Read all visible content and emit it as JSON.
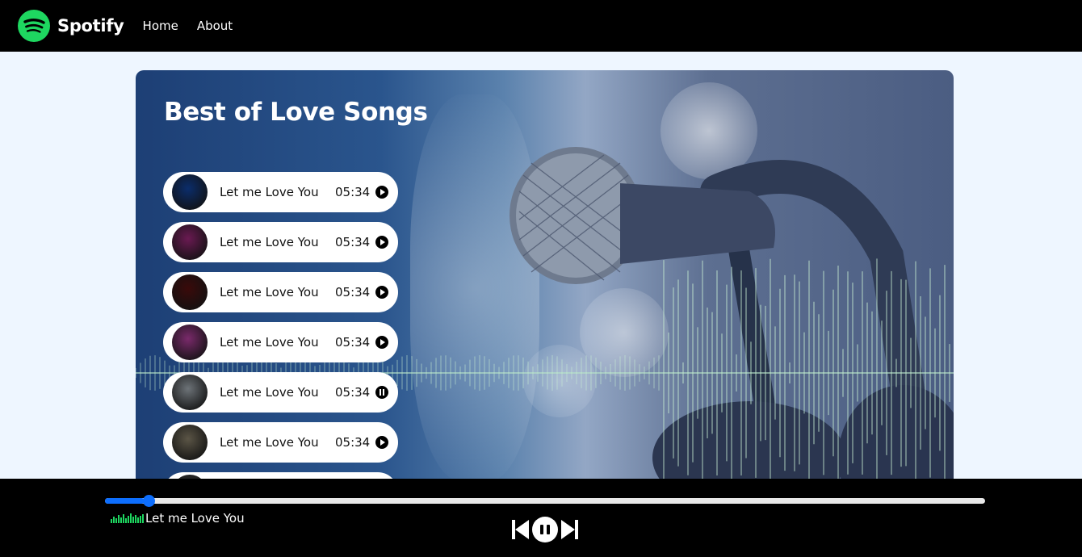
{
  "navbar": {
    "brand": "Spotify",
    "links": [
      "Home",
      "About"
    ]
  },
  "hero": {
    "title": "Best of Love Songs"
  },
  "songs": [
    {
      "name": "Let me Love You",
      "duration": "05:34",
      "state": "play",
      "cover_color": "#0b2d6b"
    },
    {
      "name": "Let me Love You",
      "duration": "05:34",
      "state": "play",
      "cover_color": "#6a1a52"
    },
    {
      "name": "Let me Love You",
      "duration": "05:34",
      "state": "play",
      "cover_color": "#3a0a0a"
    },
    {
      "name": "Let me Love You",
      "duration": "05:34",
      "state": "play",
      "cover_color": "#7a2a6b"
    },
    {
      "name": "Let me Love You",
      "duration": "05:34",
      "state": "pause",
      "cover_color": "#6d7378"
    },
    {
      "name": "Let me Love You",
      "duration": "05:34",
      "state": "play",
      "cover_color": "#5b5546"
    }
  ],
  "player": {
    "now_playing": "Let me Love You",
    "progress": 0.045,
    "state": "playing"
  },
  "colors": {
    "brand_green": "#1ed760",
    "progress_blue": "#0d6efd",
    "page_bg": "#eef6ff"
  }
}
